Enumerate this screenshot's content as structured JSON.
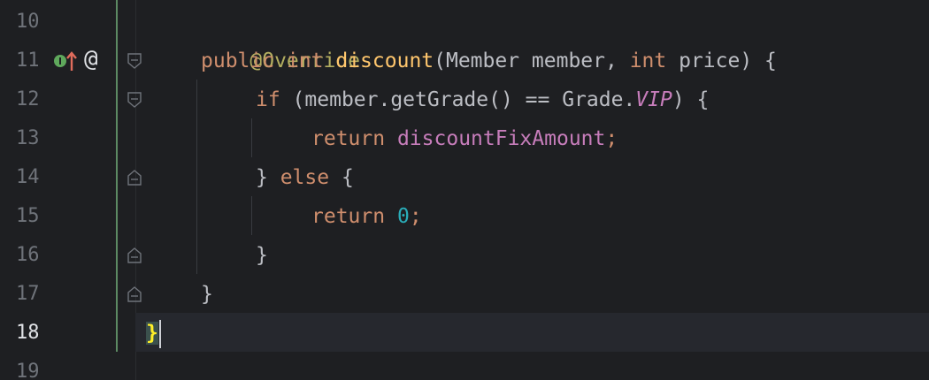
{
  "editor": {
    "line_numbers": [
      "10",
      "11",
      "12",
      "13",
      "14",
      "15",
      "16",
      "17",
      "18",
      "19"
    ],
    "current_line": "18",
    "lines": {
      "l10": {
        "annotation": "@Override"
      },
      "l11": {
        "kw_public": "public",
        "kw_int": "int",
        "method_name": "discount",
        "paren_open": "(Member member, ",
        "kw_int2": "int",
        "params_rest": " price) {"
      },
      "l12": {
        "kw_if": "if",
        "cond_start": " (member.getGrade() == Grade.",
        "enum_field": "VIP",
        "cond_end": ") {"
      },
      "l13": {
        "kw_return": "return",
        "field": "discountFixAmount",
        "semicolon": ";"
      },
      "l14": {
        "brace": "} ",
        "kw_else": "else",
        "brace_open": " {"
      },
      "l15": {
        "kw_return": "return",
        "value": "0",
        "semicolon": ";"
      },
      "l16": {
        "brace": "}"
      },
      "l17": {
        "brace": "}"
      },
      "l18": {
        "brace": "}"
      }
    },
    "gutter_icons": {
      "implementation_icon": "I",
      "at_icon": "@"
    }
  }
}
